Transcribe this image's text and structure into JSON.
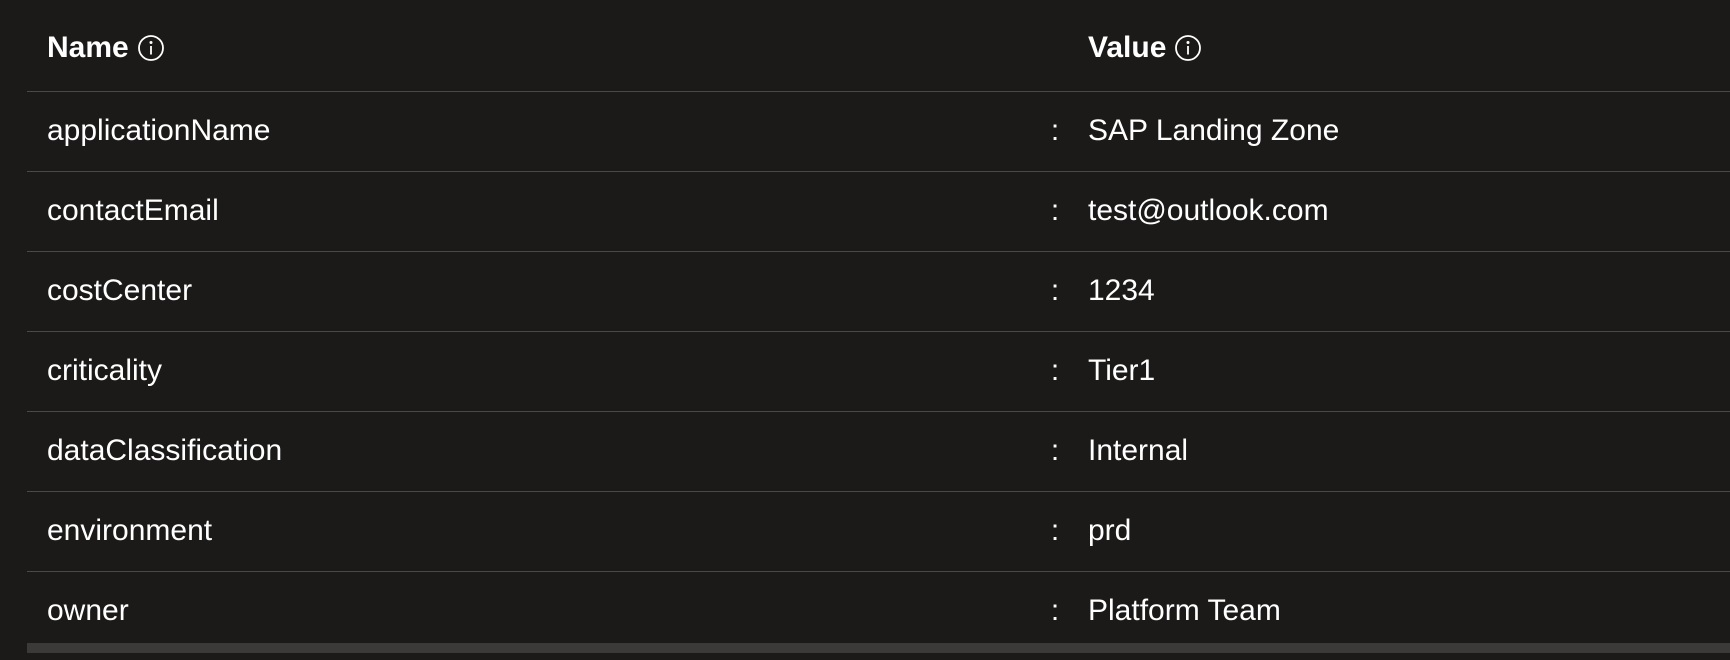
{
  "table": {
    "columns": {
      "name": "Name",
      "value": "Value",
      "name_info_icon": "info-icon",
      "value_info_icon": "info-icon"
    },
    "separator": ":",
    "rows": [
      {
        "name": "applicationName",
        "value": "SAP Landing Zone"
      },
      {
        "name": "contactEmail",
        "value": "test@outlook.com"
      },
      {
        "name": "costCenter",
        "value": "1234"
      },
      {
        "name": "criticality",
        "value": "Tier1"
      },
      {
        "name": "dataClassification",
        "value": "Internal"
      },
      {
        "name": "environment",
        "value": "prd"
      },
      {
        "name": "owner",
        "value": "Platform Team"
      }
    ]
  },
  "colors": {
    "background": "#1b1a19",
    "text": "#ffffff",
    "divider": "#4a4848"
  }
}
